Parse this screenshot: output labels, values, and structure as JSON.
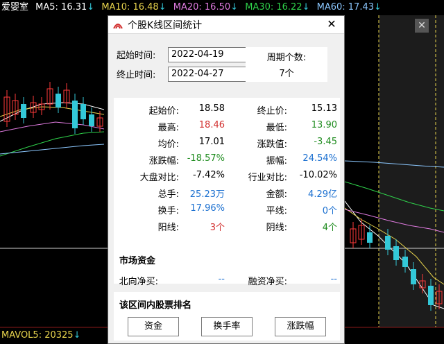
{
  "topbar": {
    "title": "爱婴室",
    "ma5": "MA5: 16.31",
    "ma10": "MA10: 16.48",
    "ma20": "MA20: 16.50",
    "ma30": "MA30: 16.22",
    "ma60": "MA60: 17.43",
    "down_arrow": "↓"
  },
  "bottombar": {
    "mavol5": "MAVOL5: 20325",
    "down_arrow": "↓"
  },
  "colors": {
    "ma5": "#ffffff",
    "ma10": "#e8d44d",
    "ma20": "#e07be0",
    "ma30": "#2fd24b",
    "ma60": "#8cc8ff",
    "up": "#ff3a3a",
    "down": "#33c8d8",
    "red_text": "#d2302f",
    "green_text": "#1f8c1f",
    "blue_text": "#1a6fd0"
  },
  "outer_close": "✕",
  "dialog": {
    "title": "个股K线区间统计",
    "close": "✕",
    "start_label": "起始时间:",
    "end_label": "终止时间:",
    "start_date": "2022-04-19",
    "end_date": "2022-04-27",
    "period_label": "周期个数:",
    "period_value": "7个",
    "stats": [
      {
        "k1": "起始价:",
        "v1": "18.58",
        "c1": "black",
        "k2": "终止价:",
        "v2": "15.13",
        "c2": "black"
      },
      {
        "k1": "最高:",
        "v1": "18.46",
        "c1": "red",
        "k2": "最低:",
        "v2": "13.90",
        "c2": "green"
      },
      {
        "k1": "均价:",
        "v1": "17.01",
        "c1": "black",
        "k2": "涨跌值:",
        "v2": "-3.45",
        "c2": "green"
      },
      {
        "k1": "涨跌幅:",
        "v1": "-18.57%",
        "c1": "green",
        "k2": "振幅:",
        "v2": "24.54%",
        "c2": "blue"
      },
      {
        "k1": "大盘对比:",
        "v1": "-7.42%",
        "c1": "black",
        "k2": "行业对比:",
        "v2": "-10.02%",
        "c2": "black"
      },
      {
        "k1": "总手:",
        "v1": "25.23万",
        "c1": "blue",
        "k2": "金额:",
        "v2": "4.29亿",
        "c2": "blue"
      },
      {
        "k1": "换手:",
        "v1": "17.96%",
        "c1": "blue",
        "k2": "平线:",
        "v2": "0个",
        "c2": "blue"
      },
      {
        "k1": "阳线:",
        "v1": "3个",
        "c1": "red",
        "k2": "阴线:",
        "v2": "4个",
        "c2": "green"
      }
    ],
    "market_funds": {
      "heading": "市场资金",
      "north_label": "北向净买:",
      "north_value": "--",
      "margin_label": "融资净买:",
      "margin_value": "--"
    },
    "ranking": {
      "heading": "该区间内股票排名",
      "buttons": [
        "资金",
        "换手率",
        "涨跌幅"
      ]
    }
  }
}
